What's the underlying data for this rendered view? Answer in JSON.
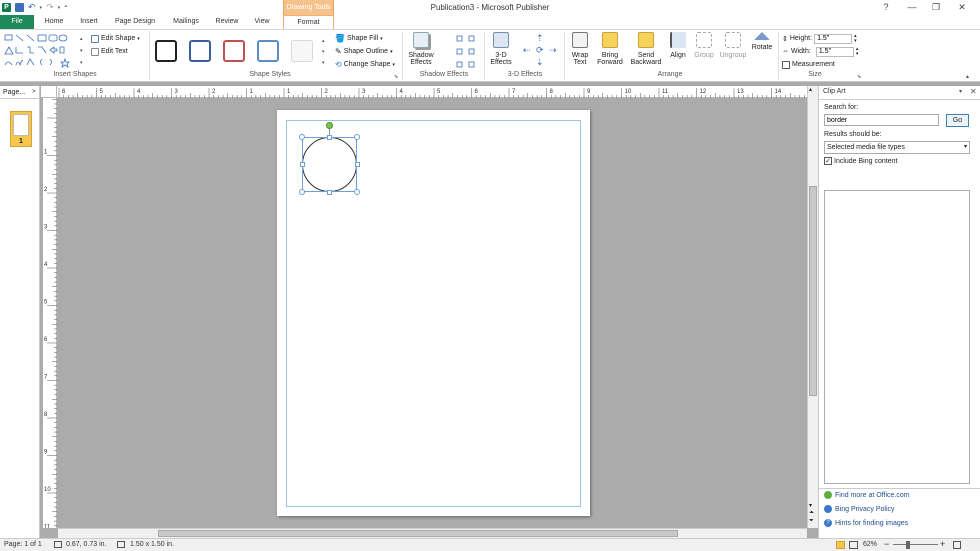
{
  "window": {
    "title": "Publication3  -  Microsoft Publisher",
    "context_tab": "Drawing Tools",
    "controls": [
      "?",
      "—",
      "❐",
      "✕"
    ]
  },
  "tabs": [
    {
      "label": "File"
    },
    {
      "label": "Home"
    },
    {
      "label": "Insert"
    },
    {
      "label": "Page Design"
    },
    {
      "label": "Mailings"
    },
    {
      "label": "Review"
    },
    {
      "label": "View"
    },
    {
      "label": "Format"
    }
  ],
  "ribbon": {
    "edit_shape": "Edit Shape",
    "edit_text": "Edit Text",
    "group_insert_shapes": "Insert Shapes",
    "group_shape_styles": "Shape Styles",
    "shape_fill": "Shape Fill",
    "shape_outline": "Shape Outline",
    "change_shape": "Change Shape",
    "shadow_effects_btn_1": "Shadow",
    "shadow_effects_btn_2": "Effects",
    "group_shadow_effects": "Shadow Effects",
    "three_d_btn_1": "3-D",
    "three_d_btn_2": "Effects",
    "group_3d_effects": "3-D Effects",
    "wrap_text_1": "Wrap",
    "wrap_text_2": "Text",
    "bring_forward_1": "Bring",
    "bring_forward_2": "Forward",
    "send_backward_1": "Send",
    "send_backward_2": "Backward",
    "align": "Align",
    "group": "Group",
    "ungroup": "Ungroup",
    "rotate": "Rotate",
    "group_arrange": "Arrange",
    "height_label": "Height:",
    "height_value": "1.5\"",
    "width_label": "Width:",
    "width_value": "1.5\"",
    "measurement": "Measurement",
    "group_size": "Size",
    "style_colors": [
      "#222222",
      "#3a5f9a",
      "#c0504d",
      "#5b8bc9",
      "#e8e8e8"
    ]
  },
  "pagenav": {
    "header": "Page...",
    "page_number": "1"
  },
  "rulers": {
    "h_numbers": [
      "6",
      "5",
      "4",
      "3",
      "2",
      "1",
      "1",
      "2",
      "3",
      "4",
      "5",
      "6",
      "7",
      "8",
      "9",
      "10",
      "11",
      "12",
      "13",
      "14"
    ],
    "v_numbers": [
      "1",
      "2",
      "3",
      "4",
      "5",
      "6",
      "7",
      "8",
      "9",
      "10",
      "11"
    ]
  },
  "clipart": {
    "title": "Clip Art",
    "search_label": "Search for:",
    "search_value": "border",
    "go_button": "Go",
    "results_label": "Results should be:",
    "results_value": "Selected media file types",
    "include_bing": "Include Bing content",
    "links": [
      {
        "label": "Find more at Office.com"
      },
      {
        "label": "Bing Privacy Policy"
      },
      {
        "label": "Hints for finding images"
      }
    ]
  },
  "status": {
    "page": "Page: 1 of 1",
    "position": "0.67, 0.73 in.",
    "size": "1.50 x 1.50 in.",
    "zoom": "62%"
  }
}
